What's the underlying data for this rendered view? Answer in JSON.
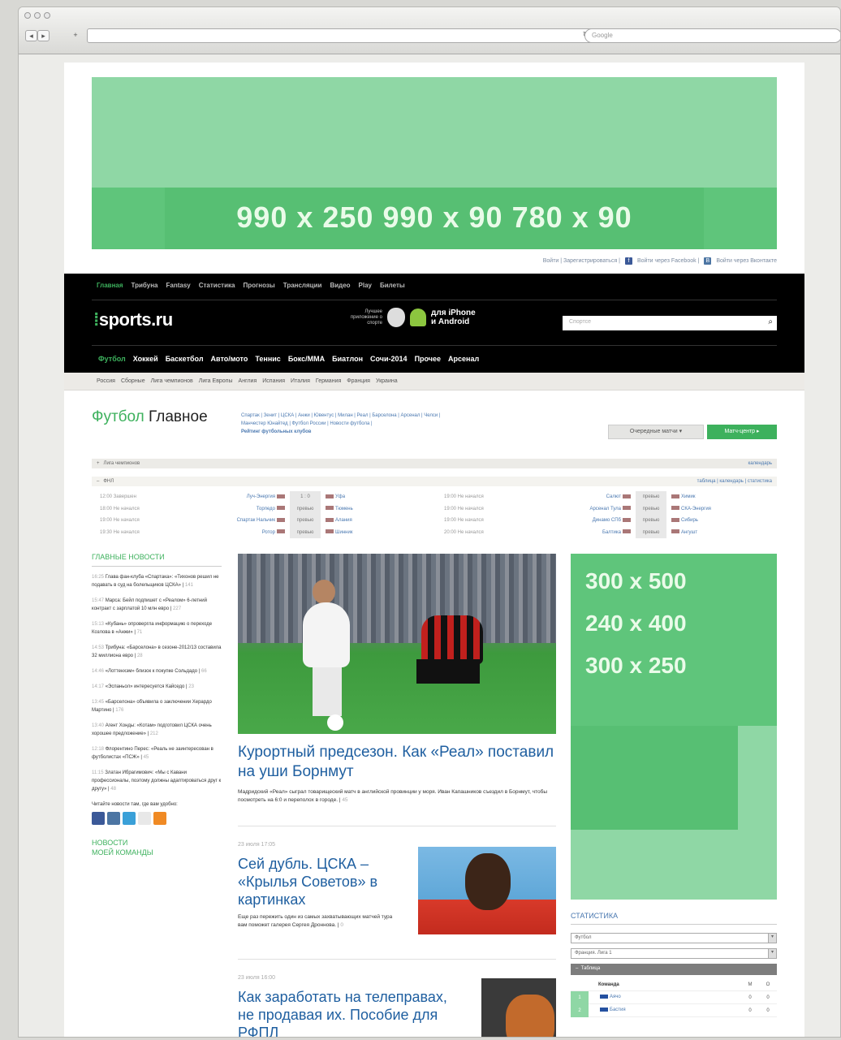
{
  "browser": {
    "search_placeholder": "Google"
  },
  "ads": {
    "top": "990 x 250   990 x 90   780 x 90",
    "side": [
      "300 x 500",
      "240 x 400",
      "300 x 250"
    ]
  },
  "login": {
    "links": "Войти | Зарегистрироваться |",
    "facebook": "Войти через Facebook |",
    "vk": "Войти через Вконтакте"
  },
  "topnav": [
    "Главная",
    "Трибуна",
    "Fantasy",
    "Статистика",
    "Прогнозы",
    "Трансляции",
    "Видео",
    "Play",
    "Билеты"
  ],
  "logo": {
    "text": "sports.ru"
  },
  "apps": {
    "caption": "Лучшее приложение о спорте",
    "platforms": "для iPhone\nи Android"
  },
  "search": {
    "placeholder": "Спортсе"
  },
  "sportnav": [
    "Футбол",
    "Хоккей",
    "Баскетбол",
    "Авто/мото",
    "Теннис",
    "Бокс/ММА",
    "Биатлон",
    "Сочи-2014",
    "Прочее",
    "Арсенал"
  ],
  "subnav": [
    "Россия",
    "Сборные",
    "Лига чемпионов",
    "Лига Европы",
    "Англия",
    "Испания",
    "Италия",
    "Германия",
    "Франция",
    "Украина"
  ],
  "page": {
    "title_green": "Футбол",
    "title_dark": "Главное"
  },
  "quicklinks": {
    "line1": "Спартак | Зенит | ЦСКА | Анжи | Ювентус | Милан | Реал | Барселона | Арсенал | Челси |",
    "line2": "Манчестер Юнайтед | Футбол России | Новости футбола |",
    "line3": "Рейтинг футбольных клубов"
  },
  "buttons": {
    "upcoming": "Очередные матчи ▾",
    "match_center": "Матч-центр ▸"
  },
  "tournaments": {
    "cl": "Лига чемпионов",
    "cl_right": "календарь",
    "fnl": "ФНЛ",
    "fnl_right": "таблица | календарь | статистика"
  },
  "matches_left": {
    "times": [
      "12:00 Завершен",
      "18:00 Не начался",
      "19:00 Не начался",
      "19:30 Не начался"
    ],
    "home": [
      "Луч-Энергия",
      "Торпедо",
      "Спартак Нальчик",
      "Ротор"
    ],
    "scores": [
      "1 : 0",
      "превью",
      "превью",
      "превью"
    ],
    "away": [
      "Уфа",
      "Тюмень",
      "Алания",
      "Шинник"
    ]
  },
  "matches_right": {
    "times": [
      "19:00 Не начался",
      "19:00 Не начался",
      "19:00 Не начался",
      "20:00 Не начался"
    ],
    "home": [
      "Салют",
      "Арсенал Тула",
      "Динамо СПб",
      "Балтика"
    ],
    "scores": [
      "превью",
      "превью",
      "превью",
      "превью"
    ],
    "away": [
      "Химик",
      "СКА-Энергия",
      "Сибирь",
      "Ангушт"
    ]
  },
  "news": {
    "header": "ГЛАВНЫЕ НОВОСТИ",
    "items": [
      {
        "time": "16:25",
        "text": "Глава фан-клуба «Спартака»: «Тихонов решил не подавать в суд на болельщиков ЦСКА»",
        "count": "141"
      },
      {
        "time": "15:47",
        "text": "Марса: Бейл подпишет с «Реалом» 6-летний контракт с зарплатой 10 млн евро",
        "count": "227"
      },
      {
        "time": "15:13",
        "text": "«Кубань» опровергла информацию о переходе Козлова в «Анжи»",
        "count": "71"
      },
      {
        "time": "14:53",
        "text": "Трибуна: «Барселона» в сезоне-2012/13 составила 32 миллиона евро",
        "count": "28"
      },
      {
        "time": "14:46",
        "text": "«Лоттенхэм» близок к покупке Сольдадо",
        "count": "66"
      },
      {
        "time": "14:17",
        "text": "«Эспаньол» интересуется Кайседо",
        "count": "23"
      },
      {
        "time": "13:45",
        "text": "«Барселона» объявила о заключении Херардо Мартино",
        "count": "176"
      },
      {
        "time": "13:40",
        "text": "Агент Хонды: «Котам» подготовил ЦСКА очень хорошее предложение»",
        "count": "212"
      },
      {
        "time": "12:18",
        "text": "Флорентино Перес: «Реаль не заинтересован в футболистах «ПСЖ»",
        "count": "45"
      },
      {
        "time": "11:15",
        "text": "Златан Ибрагимович: «Мы с Кавани профессионалы, поэтому должны адаптироваться друг к другу»",
        "count": "48"
      }
    ],
    "social_note": "Читайте новости там, где вам удобно:",
    "my_team_line1": "НОВОСТИ",
    "my_team_line2": "МОЕЙ КОМАНДЫ"
  },
  "main": {
    "headline": "Курортный предсезон. Как «Реал» поставил на уши Борнмут",
    "lead": "Мадридский «Реал» сыграл товарищеский матч в английской провинции у моря. Иван Капашников съездил в Борнмут, чтобы посмотреть на 6:0 и переполох в городе.",
    "lead_count": "45",
    "date2": "23 июля 17:05",
    "headline2": "Сей дубль. ЦСКА – «Крылья Советов» в картинках",
    "lead2": "Еще раз пережить один из самых захватывающих матчей тура вам поможет галерея Сергея Дроннова.",
    "lead2_count": "0",
    "date3": "23 июля 16:00",
    "headline3": "Как заработать на телеправах, не продавая их. Пособие для РФПЛ"
  },
  "stats": {
    "header": "СТАТИСТИКА",
    "sport": "Футбол",
    "league": "Франция. Лига 1",
    "table_label": "Таблица",
    "col_team": "Команда",
    "col_m": "М",
    "col_o": "О",
    "rows": [
      {
        "n": "1",
        "team": "Аячо",
        "m": "0",
        "o": "0"
      },
      {
        "n": "2",
        "team": "Бастия",
        "m": "0",
        "o": "0"
      }
    ]
  },
  "colors": {
    "accent": "#3db15d",
    "link": "#1f5fa0",
    "ad_light": "#8fd7a5",
    "ad_mid": "#5fc57b"
  }
}
